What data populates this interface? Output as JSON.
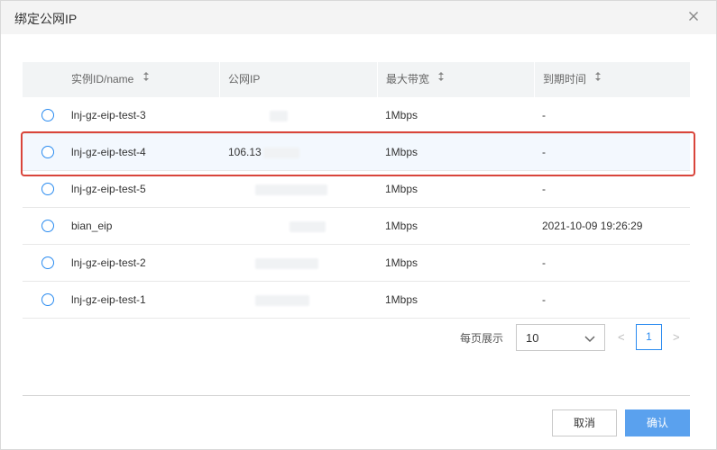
{
  "dialog": {
    "title": "绑定公网IP",
    "close_icon": "close-icon"
  },
  "table": {
    "columns": [
      {
        "label": "实例ID/name",
        "sortable": true
      },
      {
        "label": "公网IP",
        "sortable": false
      },
      {
        "label": "最大带宽",
        "sortable": true
      },
      {
        "label": "到期时间",
        "sortable": true
      }
    ],
    "rows": [
      {
        "name": "lnj-gz-eip-test-3",
        "ip": "",
        "bandwidth": "1Mbps",
        "expiry": "-",
        "highlighted": false
      },
      {
        "name": "lnj-gz-eip-test-4",
        "ip": "106.13",
        "bandwidth": "1Mbps",
        "expiry": "-",
        "highlighted": true
      },
      {
        "name": "lnj-gz-eip-test-5",
        "ip": "",
        "bandwidth": "1Mbps",
        "expiry": "-",
        "highlighted": false
      },
      {
        "name": "bian_eip",
        "ip": "",
        "bandwidth": "1Mbps",
        "expiry": "2021-10-09 19:26:29",
        "highlighted": false
      },
      {
        "name": "lnj-gz-eip-test-2",
        "ip": "",
        "bandwidth": "1Mbps",
        "expiry": "-",
        "highlighted": false
      },
      {
        "name": "lnj-gz-eip-test-1",
        "ip": "",
        "bandwidth": "1Mbps",
        "expiry": "-",
        "highlighted": false
      }
    ]
  },
  "pagination": {
    "per_page_label": "每页展示",
    "page_size": "10",
    "prev": "<",
    "current_page": "1",
    "next": ">"
  },
  "footer": {
    "cancel_label": "取消",
    "confirm_label": "确认"
  },
  "colors": {
    "accent": "#2a8bf0",
    "confirm_bg": "#5aa1ee",
    "highlight_border": "#d9453b",
    "header_bg": "#f4f4f4"
  }
}
